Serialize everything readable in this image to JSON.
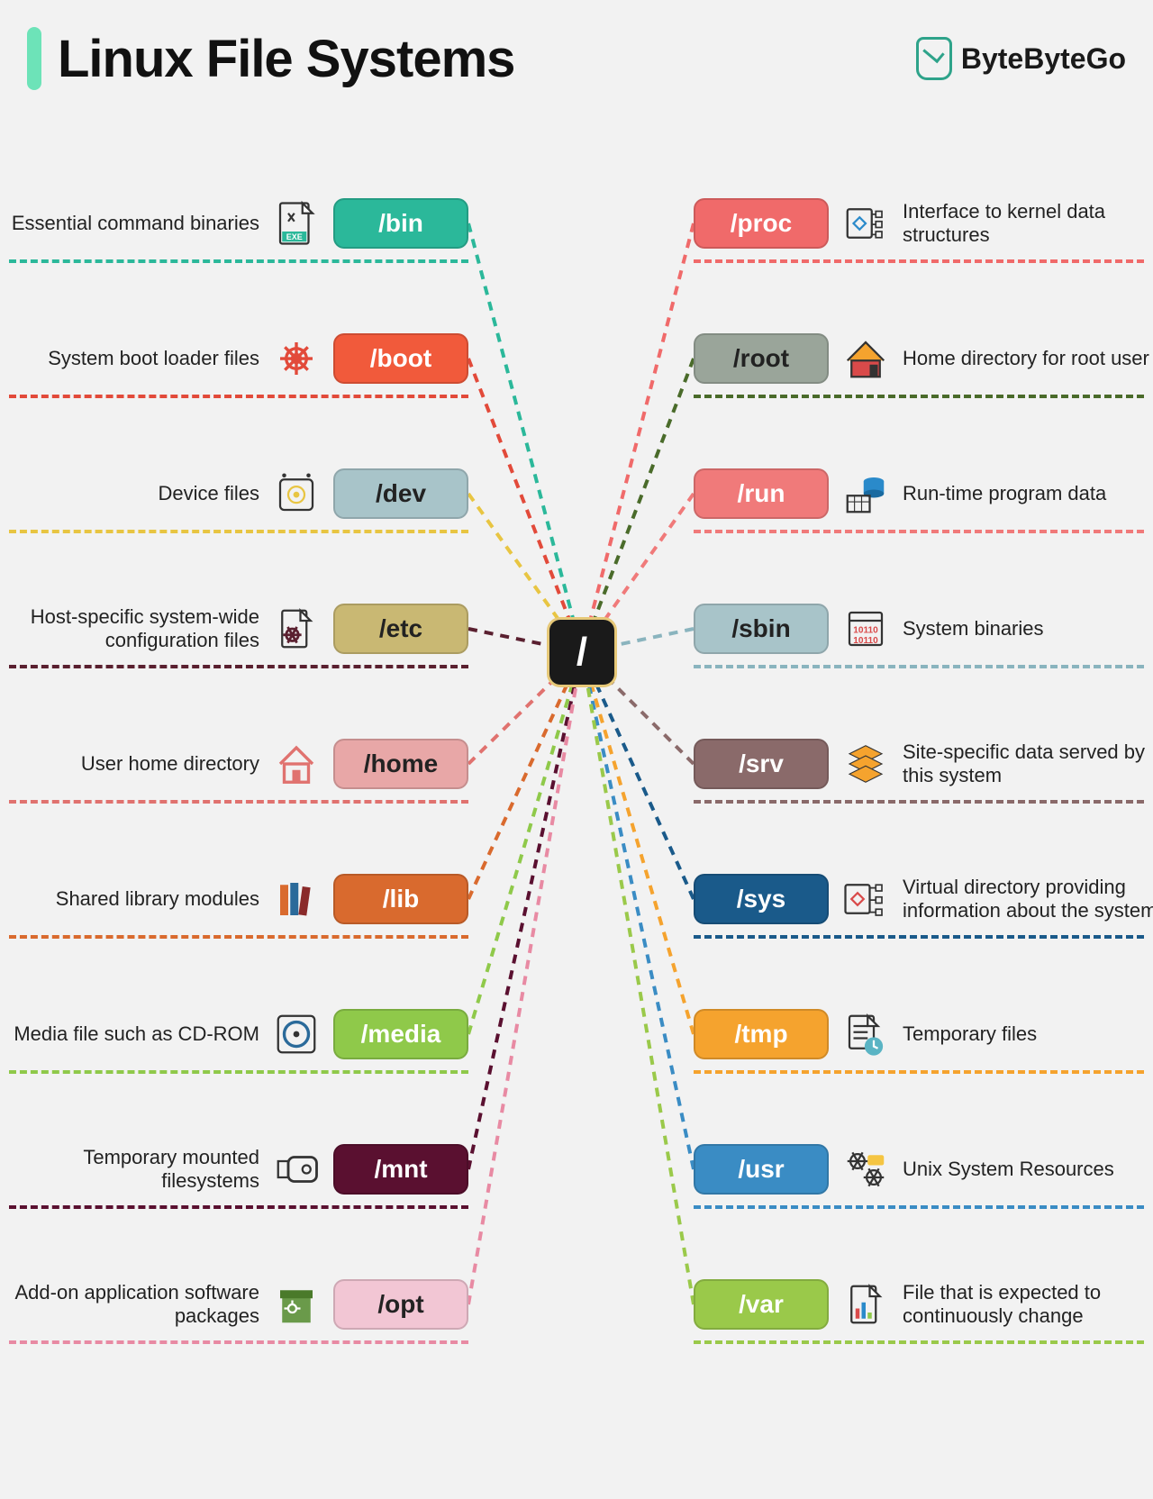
{
  "title": "Linux File Systems",
  "brand": "ByteByteGo",
  "root": "/",
  "left": [
    {
      "name": "/bin",
      "desc": "Essential command binaries",
      "bg": "#2bb89a",
      "fg": "#fff",
      "line": "#2bb89a",
      "icon": "exe"
    },
    {
      "name": "/boot",
      "desc": "System boot loader files",
      "bg": "#f15a3b",
      "fg": "#fff",
      "line": "#e24a3a",
      "icon": "gear"
    },
    {
      "name": "/dev",
      "desc": "Device files",
      "bg": "#a8c4c9",
      "fg": "#222",
      "line": "#e8c542",
      "icon": "device"
    },
    {
      "name": "/etc",
      "desc": "Host-specific system-wide configuration files",
      "bg": "#c9b873",
      "fg": "#222",
      "line": "#5a2030",
      "icon": "configfile"
    },
    {
      "name": "/home",
      "desc": "User home directory",
      "bg": "#e8a7a7",
      "fg": "#222",
      "line": "#e0726f",
      "icon": "house"
    },
    {
      "name": "/lib",
      "desc": "Shared library modules",
      "bg": "#d96a2e",
      "fg": "#fff",
      "line": "#d96a2e",
      "icon": "books"
    },
    {
      "name": "/media",
      "desc": "Media file such as CD-ROM",
      "bg": "#8fc94a",
      "fg": "#fff",
      "line": "#8fc94a",
      "icon": "disc"
    },
    {
      "name": "/mnt",
      "desc": "Temporary mounted filesystems",
      "bg": "#5a1030",
      "fg": "#fff",
      "line": "#5a1030",
      "icon": "usb"
    },
    {
      "name": "/opt",
      "desc": "Add-on application software packages",
      "bg": "#f2c6d4",
      "fg": "#222",
      "line": "#e88aa3",
      "icon": "package"
    }
  ],
  "right": [
    {
      "name": "/proc",
      "desc": "Interface to kernel data structures",
      "bg": "#f06a6a",
      "fg": "#fff",
      "line": "#f06a6a",
      "icon": "kernel"
    },
    {
      "name": "/root",
      "desc": "Home directory for root user",
      "bg": "#9aa59a",
      "fg": "#222",
      "line": "#4a6b2a",
      "icon": "house2"
    },
    {
      "name": "/run",
      "desc": "Run-time program data",
      "bg": "#f07a7a",
      "fg": "#fff",
      "line": "#f07a7a",
      "icon": "runtime"
    },
    {
      "name": "/sbin",
      "desc": "System binaries",
      "bg": "#a8c4c9",
      "fg": "#222",
      "line": "#8ab4be",
      "icon": "binary"
    },
    {
      "name": "/srv",
      "desc": "Site-specific data served by this system",
      "bg": "#8a6a6a",
      "fg": "#fff",
      "line": "#8a6a6a",
      "icon": "stack"
    },
    {
      "name": "/sys",
      "desc": "Virtual directory providing information about the system",
      "bg": "#1a5a8a",
      "fg": "#fff",
      "line": "#1a5a8a",
      "icon": "sysinfo"
    },
    {
      "name": "/tmp",
      "desc": "Temporary files",
      "bg": "#f5a32e",
      "fg": "#fff",
      "line": "#f5a32e",
      "icon": "tmp"
    },
    {
      "name": "/usr",
      "desc": "Unix System Resources",
      "bg": "#3a8cc4",
      "fg": "#fff",
      "line": "#3a8cc4",
      "icon": "gears"
    },
    {
      "name": "/var",
      "desc": "File that is expected to continuously change",
      "bg": "#9ac94a",
      "fg": "#fff",
      "line": "#9ac94a",
      "icon": "chartfile"
    }
  ]
}
